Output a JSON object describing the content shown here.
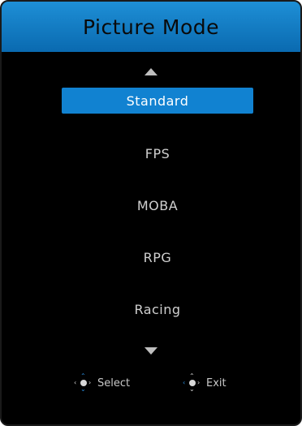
{
  "header": {
    "title": "Picture Mode"
  },
  "menu": {
    "options": [
      {
        "label": "Standard",
        "selected": true
      },
      {
        "label": "FPS",
        "selected": false
      },
      {
        "label": "MOBA",
        "selected": false
      },
      {
        "label": "RPG",
        "selected": false
      },
      {
        "label": "Racing",
        "selected": false
      }
    ]
  },
  "footer": {
    "select_label": "Select",
    "exit_label": "Exit"
  },
  "icons": {
    "scroll_up": "triangle-up-icon",
    "scroll_down": "triangle-down-icon",
    "select_hint": "joystick-up-down-icon",
    "exit_hint": "joystick-left-icon"
  },
  "colors": {
    "header": "#1182d1",
    "selected_bg": "#1182d1",
    "background": "#000000",
    "text": "#d0d0d0",
    "joystick_highlight": "#2a8fe0"
  }
}
